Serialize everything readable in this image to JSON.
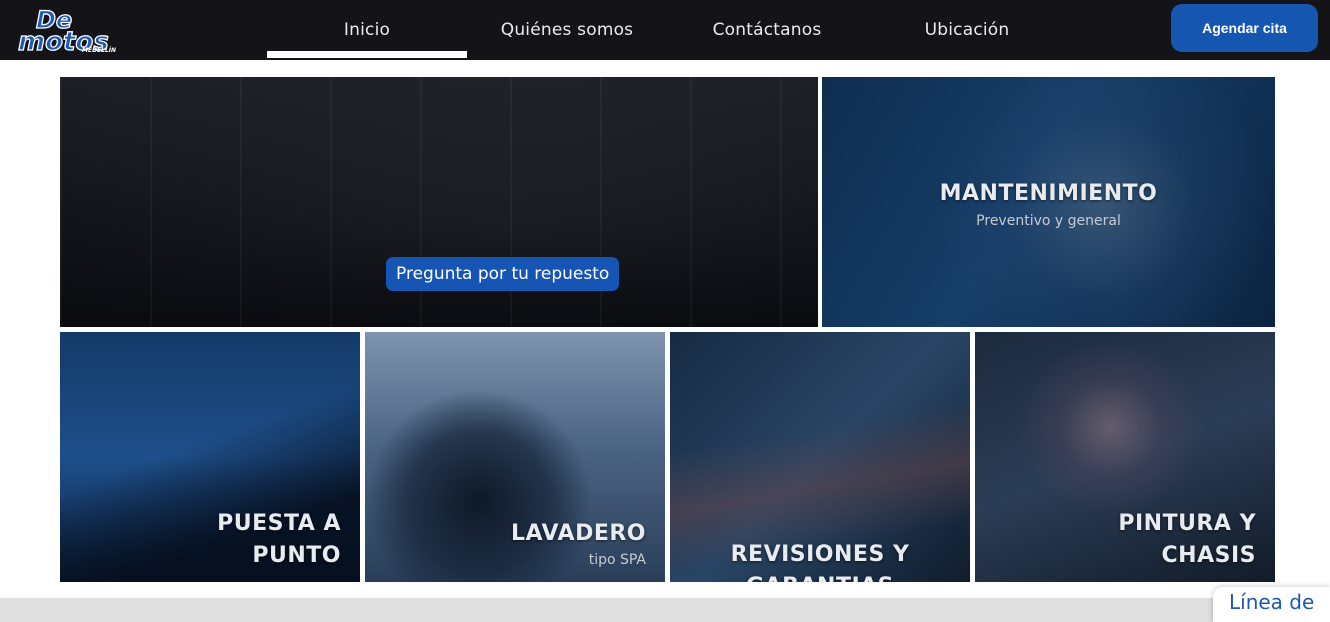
{
  "brand": {
    "logo_text": "De motos",
    "logo_subtext": "MEDELLÍN",
    "colors": {
      "header_bg": "#131318",
      "accent": "#1557b0",
      "nav_text": "#e9ebef"
    }
  },
  "nav": {
    "items": [
      {
        "label": "Inicio",
        "active": true
      },
      {
        "label": "Quiénes somos",
        "active": false
      },
      {
        "label": "Contáctanos",
        "active": false
      },
      {
        "label": "Ubicación",
        "active": false
      }
    ],
    "cta_label": "Agendar cita"
  },
  "hero": {
    "button_label": "Pregunta por tu repuesto"
  },
  "tiles": [
    {
      "title": "MANTENIMIENTO",
      "subtitle": "Preventivo y general"
    },
    {
      "title_line1": "PUESTA A",
      "title_line2": "PUNTO"
    },
    {
      "title": "LAVADERO",
      "subtitle": "tipo SPA"
    },
    {
      "title": "REVISIONES Y GARANTIAS"
    },
    {
      "title_line1": "PINTURA Y",
      "title_line2": "CHASIS"
    }
  ],
  "chat": {
    "label": "Línea de"
  }
}
